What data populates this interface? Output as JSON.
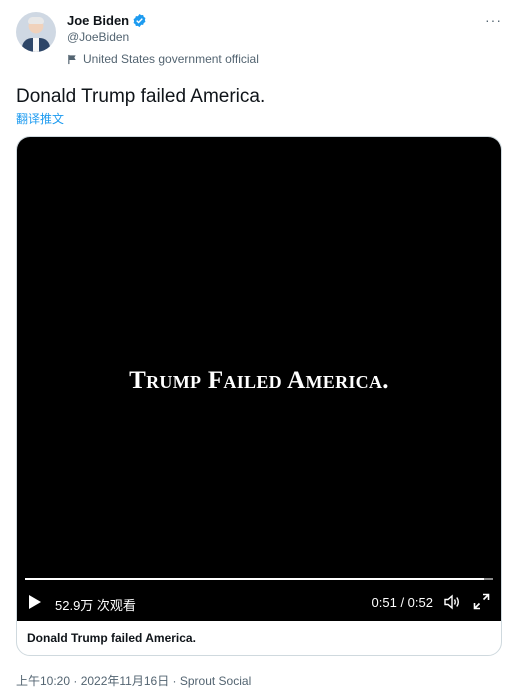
{
  "author": {
    "name": "Joe Biden",
    "handle": "@JoeBiden",
    "label": "United States government official",
    "verified_color": "#1d9bf0"
  },
  "tweet": {
    "text": "Donald Trump failed America.",
    "translate_label": "翻译推文"
  },
  "video": {
    "title_text": "Trump Failed America.",
    "views": "52.9万 次观看",
    "time": "0:51 / 0:52",
    "progress": 0.98,
    "caption": "Donald Trump failed America."
  },
  "meta": {
    "time_date": "上午10:20 · 2022年11月16日 · ",
    "source": "Sprout Social"
  },
  "icons": [
    "more-icon",
    "verified-badge-icon",
    "flag-icon",
    "play-icon",
    "volume-icon",
    "fullscreen-icon"
  ]
}
